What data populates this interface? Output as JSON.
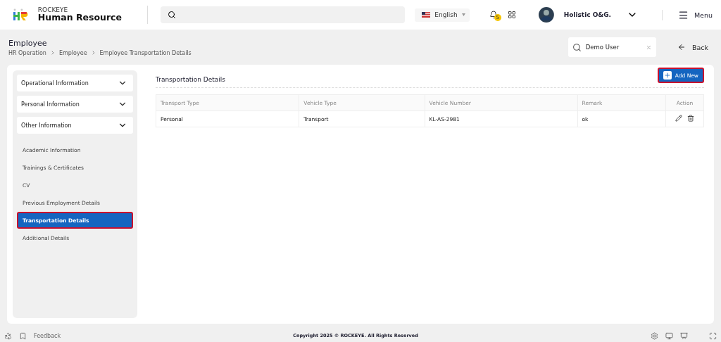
{
  "header": {
    "brand_top": "ROCKEYE",
    "brand_name": "Human Resource",
    "language": "English",
    "notification_count": "5",
    "user_name": "Holistic O&G.",
    "menu_label": "Menu"
  },
  "page": {
    "title": "Employee",
    "breadcrumb": [
      "HR Operation",
      "Employee",
      "Employee Transportation Details"
    ],
    "employee_search": {
      "value": "Demo User"
    },
    "back_label": "Back"
  },
  "sidebar": {
    "sections": [
      {
        "label": "Operational Information",
        "expanded": false
      },
      {
        "label": "Personal Information",
        "expanded": false
      },
      {
        "label": "Other Information",
        "expanded": true,
        "children": [
          {
            "label": "Academic Information",
            "selected": false
          },
          {
            "label": "Trainings & Certificates",
            "selected": false
          },
          {
            "label": "CV",
            "selected": false
          },
          {
            "label": "Previous Employment Details",
            "selected": false
          },
          {
            "label": "Transportation Details",
            "selected": true
          },
          {
            "label": "Additional Details",
            "selected": false
          }
        ]
      }
    ]
  },
  "content": {
    "title": "Transportation Details",
    "add_button": "Add New",
    "table": {
      "columns": [
        "Transport Type",
        "Vehicle Type",
        "Vehicle Number",
        "Remark",
        "Action"
      ],
      "rows": [
        {
          "cells": [
            "Personal",
            "Transport",
            "KL-AS-2981",
            "ok"
          ]
        }
      ]
    }
  },
  "footer": {
    "feedback": "Feedback",
    "copyright": "Copyright 2025 © ROCKEYE. All Rights Reserved"
  }
}
